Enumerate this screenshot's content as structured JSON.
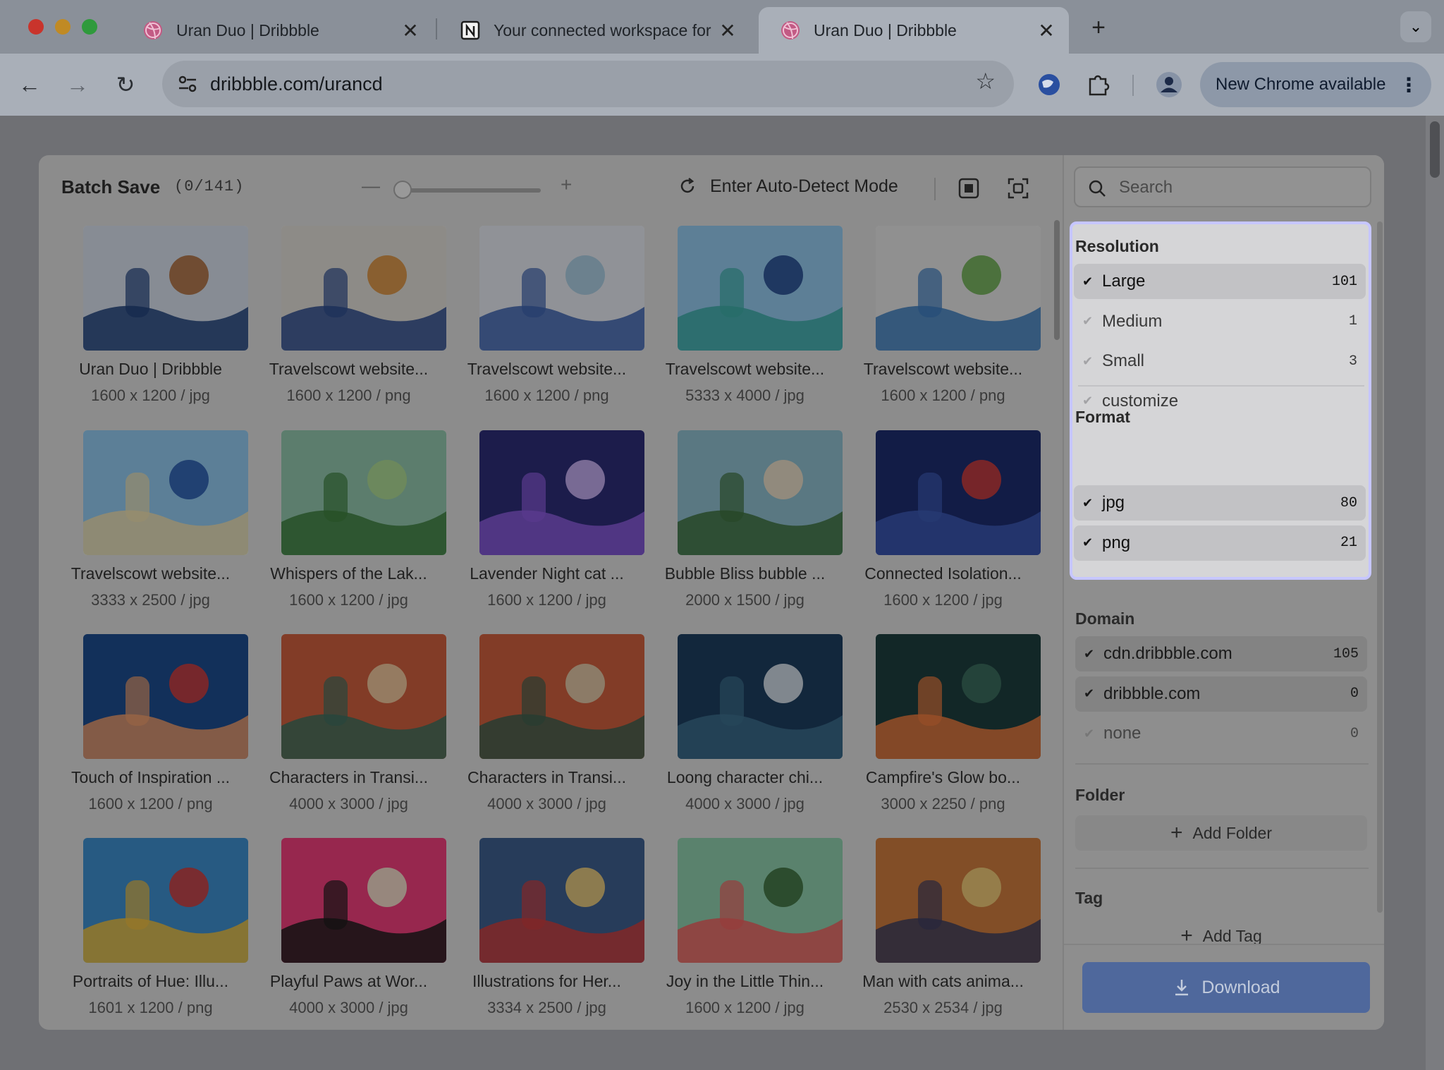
{
  "browser": {
    "tabs": [
      {
        "title": "Uran Duo | Dribbble",
        "icon": "dribbble-icon",
        "active": false
      },
      {
        "title": "Your connected workspace for",
        "icon": "notion-icon",
        "active": false
      },
      {
        "title": "Uran Duo | Dribbble",
        "icon": "dribbble-icon",
        "active": true
      }
    ],
    "close_glyph": "✕",
    "new_tab_glyph": "+",
    "tab_menu_glyph": "⌄",
    "url": "dribbble.com/urancd",
    "update_button": "New Chrome available",
    "update_menu_glyph": "⋮"
  },
  "panel": {
    "title": "Batch Save",
    "count": "(0/141)",
    "zoom_minus": "—",
    "zoom_plus": "+",
    "zoom_level": 0.0,
    "auto_detect": "Enter Auto-Detect Mode"
  },
  "images": [
    {
      "name": "Uran Duo | Dribbble",
      "meta": "1600 x 1200 / jpg",
      "colors": [
        "#cfd8e4",
        "#1f3f78",
        "#a86c3c"
      ]
    },
    {
      "name": "Travelscowt website...",
      "meta": "1600 x 1200 / png",
      "colors": [
        "#d9d6cf",
        "#2c4a8a",
        "#d28b3c"
      ]
    },
    {
      "name": "Travelscowt website...",
      "meta": "1600 x 1200 / png",
      "colors": [
        "#dde1e8",
        "#3a5ea8",
        "#a0c4d8"
      ]
    },
    {
      "name": "Travelscowt website...",
      "meta": "5333 x 4000 / jpg",
      "colors": [
        "#8fc3e6",
        "#3aa6a0",
        "#264a8c"
      ]
    },
    {
      "name": "Travelscowt website...",
      "meta": "1600 x 1200 / png",
      "colors": [
        "#dedede",
        "#3a78b8",
        "#6aa850"
      ]
    },
    {
      "name": "Travelscowt website...",
      "meta": "3333 x 2500 / jpg",
      "colors": [
        "#8ec4e8",
        "#e8d8a8",
        "#2a5aa8"
      ]
    },
    {
      "name": "Whispers of the Lak...",
      "meta": "1600 x 1200 / jpg",
      "colors": [
        "#8ec0a8",
        "#3c7a3c",
        "#a8d48c"
      ]
    },
    {
      "name": "Lavender Night cat ...",
      "meta": "1600 x 1200 / jpg",
      "colors": [
        "#2c2c74",
        "#8a5ad8",
        "#c8b0f0"
      ]
    },
    {
      "name": "Bubble Bliss bubble ...",
      "meta": "2000 x 1500 / jpg",
      "colors": [
        "#8ab8c8",
        "#3c6c3c",
        "#e8d8c0"
      ]
    },
    {
      "name": "Connected Isolation...",
      "meta": "1600 x 1200 / jpg",
      "colors": [
        "#1c2c6c",
        "#3c58b0",
        "#c83c3c"
      ]
    },
    {
      "name": "Touch of Inspiration ...",
      "meta": "1600 x 1200 / png",
      "colors": [
        "#1c4a8a",
        "#e89868",
        "#c83c3c"
      ]
    },
    {
      "name": "Characters in Transi...",
      "meta": "4000 x 3000 / jpg",
      "colors": [
        "#c85c3c",
        "#3c6c5c",
        "#e8c8a0"
      ]
    },
    {
      "name": "Characters in Transi...",
      "meta": "4000 x 3000 / jpg",
      "colors": [
        "#c85c3c",
        "#3c5c4c",
        "#d8c8a8"
      ]
    },
    {
      "name": "Loong character chi...",
      "meta": "4000 x 3000 / jpg",
      "colors": [
        "#1c3c5c",
        "#3c6c8a",
        "#d8e0e8"
      ]
    },
    {
      "name": "Campfire's Glow bo...",
      "meta": "3000 x 2250 / png",
      "colors": [
        "#1c3c3c",
        "#e8783c",
        "#3c6c5c"
      ]
    },
    {
      "name": "Portraits of Hue: Illu...",
      "meta": "1601 x 1200 / png",
      "colors": [
        "#3c8ac8",
        "#e8b83c",
        "#c83c3c"
      ]
    },
    {
      "name": "Playful Paws at Wor...",
      "meta": "4000 x 3000 / jpg",
      "colors": [
        "#e83c78",
        "#1c1c1c",
        "#e8e0c8"
      ]
    },
    {
      "name": "Illustrations for Her...",
      "meta": "3334 x 2500 / jpg",
      "colors": [
        "#3c5c8a",
        "#c83c3c",
        "#e8c878"
      ]
    },
    {
      "name": "Joy in the Little Thin...",
      "meta": "1600 x 1200 / jpg",
      "colors": [
        "#8ac8a8",
        "#e85c5c",
        "#3c6c3c"
      ]
    },
    {
      "name": "Man with cats anima...",
      "meta": "2530 x 2534 / jpg",
      "colors": [
        "#c8783c",
        "#3c3c5c",
        "#e8c878"
      ]
    }
  ],
  "filters": {
    "search_placeholder": "Search",
    "check": "✔",
    "resolution": {
      "title": "Resolution",
      "options": [
        {
          "label": "Large",
          "count": "101",
          "selected": true
        },
        {
          "label": "Medium",
          "count": "1",
          "selected": false
        },
        {
          "label": "Small",
          "count": "3",
          "selected": false
        },
        {
          "label": "customize",
          "count": "",
          "selected": false
        }
      ]
    },
    "format": {
      "title": "Format",
      "options": [
        {
          "label": "jpg",
          "count": "80",
          "selected": true
        },
        {
          "label": "png",
          "count": "21",
          "selected": true
        }
      ]
    },
    "domain": {
      "title": "Domain",
      "options": [
        {
          "label": "cdn.dribbble.com",
          "count": "105",
          "selected": true
        },
        {
          "label": "dribbble.com",
          "count": "0",
          "selected": true
        },
        {
          "label": "none",
          "count": "0",
          "selected": false
        }
      ]
    },
    "folder": {
      "title": "Folder",
      "add_label": "Add Folder"
    },
    "tag": {
      "title": "Tag",
      "add_label": "Add Tag"
    },
    "add_glyph": "+",
    "download_label": "Download"
  },
  "colors": {
    "highlight_border": "#c6c6ff",
    "download_bg": "#4f689c"
  }
}
